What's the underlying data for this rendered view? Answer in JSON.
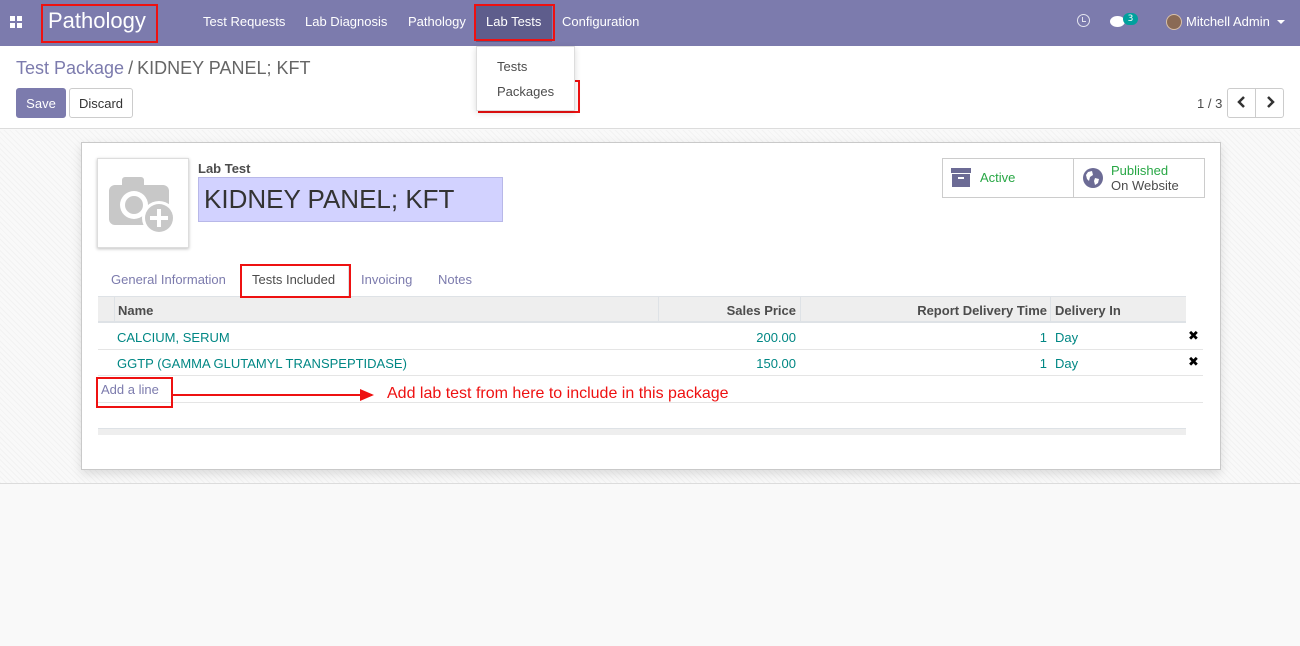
{
  "navbar": {
    "brand": "Pathology",
    "menu": [
      "Test Requests",
      "Lab Diagnosis",
      "Pathology",
      "Lab Tests",
      "Configuration"
    ],
    "chat_count": "3",
    "user_name": "Mitchell Admin"
  },
  "dropdown": {
    "items": [
      "Tests",
      "Packages"
    ]
  },
  "control_panel": {
    "breadcrumb_parent": "Test Package",
    "breadcrumb_sep": "/",
    "breadcrumb_current": "KIDNEY PANEL; KFT",
    "save_label": "Save",
    "discard_label": "Discard",
    "pager_value": "1 / 3"
  },
  "form": {
    "field_label": "Lab Test",
    "name_value": "KIDNEY PANEL; KFT",
    "smart_buttons": {
      "active_label": "Active",
      "published_label": "Published",
      "published_sub": "On Website"
    },
    "tabs": [
      "General Information",
      "Tests Included",
      "Invoicing",
      "Notes"
    ],
    "table": {
      "headers": [
        "Name",
        "Sales Price",
        "Report Delivery Time",
        "Delivery In"
      ],
      "rows": [
        {
          "name": "CALCIUM, SERUM",
          "price": "200.00",
          "time": "1",
          "unit": "Day"
        },
        {
          "name": "GGTP (GAMMA GLUTAMYL TRANSPEPTIDASE)",
          "price": "150.00",
          "time": "1",
          "unit": "Day"
        }
      ],
      "add_line": "Add a line"
    },
    "annotation": "Add lab test from here to include in this package"
  },
  "colors": {
    "primary": "#7c7bad",
    "link": "#008784",
    "highlight": "#ee1111",
    "success": "#28a745"
  }
}
